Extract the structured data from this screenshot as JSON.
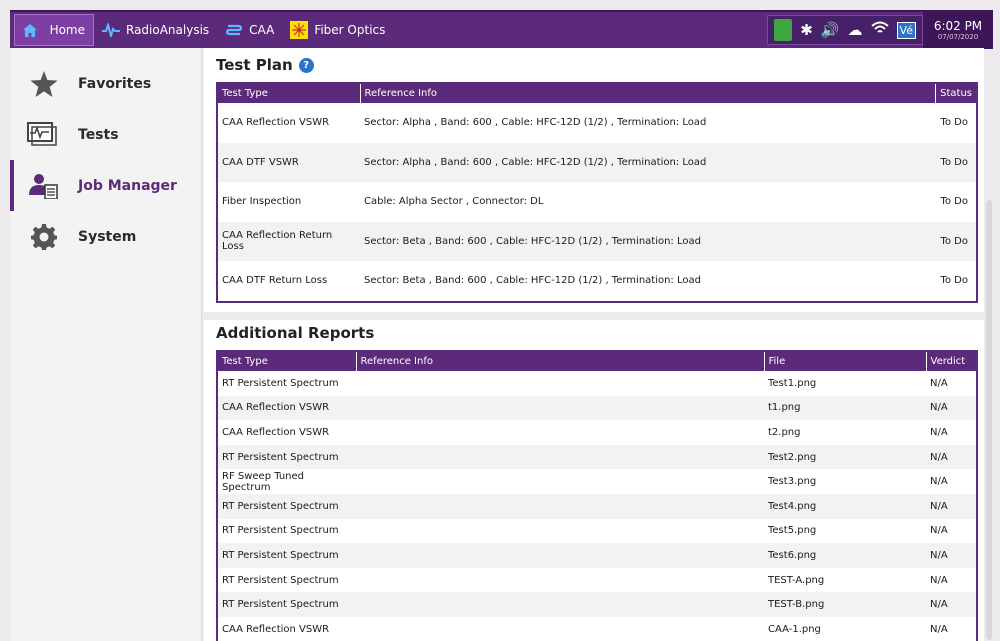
{
  "topbar": {
    "tabs": [
      {
        "label": "Home",
        "icon": "home-icon"
      },
      {
        "label": "RadioAnalysis",
        "icon": "pulse-icon"
      },
      {
        "label": "CAA",
        "icon": "caa-icon"
      },
      {
        "label": "Fiber Optics",
        "icon": "fiber-optics-icon"
      }
    ],
    "time": "6:02 PM",
    "date": "07/07/2020",
    "ve_label": "Vé"
  },
  "sidebar": {
    "items": [
      {
        "label": "Favorites",
        "icon": "star-icon"
      },
      {
        "label": "Tests",
        "icon": "tests-icon"
      },
      {
        "label": "Job Manager",
        "icon": "job-manager-icon"
      },
      {
        "label": "System",
        "icon": "gear-icon"
      }
    ]
  },
  "test_plan": {
    "title": "Test Plan",
    "columns": [
      "Test Type",
      "Reference Info",
      "Status"
    ],
    "rows": [
      {
        "type": "CAA Reflection VSWR",
        "ref": "Sector: Alpha , Band: 600 , Cable: HFC-12D (1/2) , Termination: Load",
        "status": "To Do"
      },
      {
        "type": "CAA DTF VSWR",
        "ref": "Sector: Alpha , Band: 600 , Cable: HFC-12D (1/2) , Termination: Load",
        "status": "To Do"
      },
      {
        "type": "Fiber Inspection",
        "ref": "Cable: Alpha Sector , Connector: DL",
        "status": "To Do"
      },
      {
        "type": "CAA Reflection Return Loss",
        "ref": "Sector: Beta , Band: 600 , Cable: HFC-12D (1/2) , Termination: Load",
        "status": "To Do"
      },
      {
        "type": "CAA DTF Return Loss",
        "ref": "Sector: Beta , Band: 600 , Cable: HFC-12D (1/2) , Termination: Load",
        "status": "To Do"
      }
    ]
  },
  "reports": {
    "title": "Additional Reports",
    "columns": [
      "Test Type",
      "Reference Info",
      "File",
      "Verdict"
    ],
    "rows": [
      {
        "type": "RT Persistent Spectrum",
        "ref": "",
        "file": "Test1.png",
        "verdict": "N/A"
      },
      {
        "type": "CAA Reflection VSWR",
        "ref": "",
        "file": "t1.png",
        "verdict": "N/A"
      },
      {
        "type": "CAA Reflection VSWR",
        "ref": "",
        "file": "t2.png",
        "verdict": "N/A"
      },
      {
        "type": "RT Persistent Spectrum",
        "ref": "",
        "file": "Test2.png",
        "verdict": "N/A"
      },
      {
        "type": "RF Sweep Tuned Spectrum",
        "ref": "",
        "file": "Test3.png",
        "verdict": "N/A"
      },
      {
        "type": "RT Persistent Spectrum",
        "ref": "",
        "file": "Test4.png",
        "verdict": "N/A"
      },
      {
        "type": "RT Persistent Spectrum",
        "ref": "",
        "file": "Test5.png",
        "verdict": "N/A"
      },
      {
        "type": "RT Persistent Spectrum",
        "ref": "",
        "file": "Test6.png",
        "verdict": "N/A"
      },
      {
        "type": "RT Persistent Spectrum",
        "ref": "",
        "file": "TEST-A.png",
        "verdict": "N/A"
      },
      {
        "type": "RT Persistent Spectrum",
        "ref": "",
        "file": "TEST-B.png",
        "verdict": "N/A"
      },
      {
        "type": "CAA Reflection VSWR",
        "ref": "",
        "file": "CAA-1.png",
        "verdict": "N/A"
      }
    ]
  },
  "colors": {
    "accent": "#5c2a7a",
    "help": "#2c74c9"
  }
}
